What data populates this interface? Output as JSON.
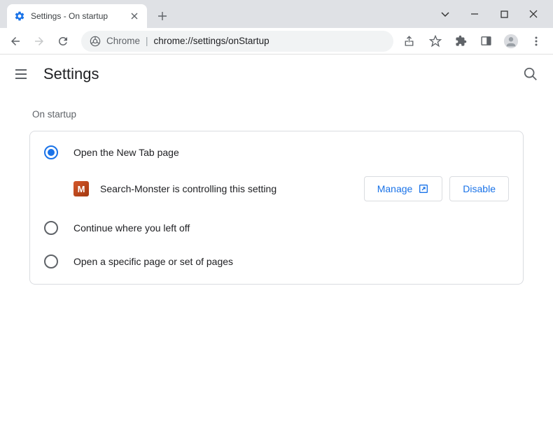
{
  "tab": {
    "title": "Settings - On startup"
  },
  "address": {
    "scheme": "Chrome",
    "url": "chrome://settings/onStartup"
  },
  "app": {
    "title": "Settings"
  },
  "section": {
    "label": "On startup"
  },
  "options": {
    "newtab": {
      "label": "Open the New Tab page",
      "selected": true
    },
    "continue": {
      "label": "Continue where you left off",
      "selected": false
    },
    "specific": {
      "label": "Open a specific page or set of pages",
      "selected": false
    }
  },
  "controlled": {
    "ext_initial": "M",
    "text": "Search-Monster is controlling this setting",
    "manage": "Manage",
    "disable": "Disable"
  }
}
